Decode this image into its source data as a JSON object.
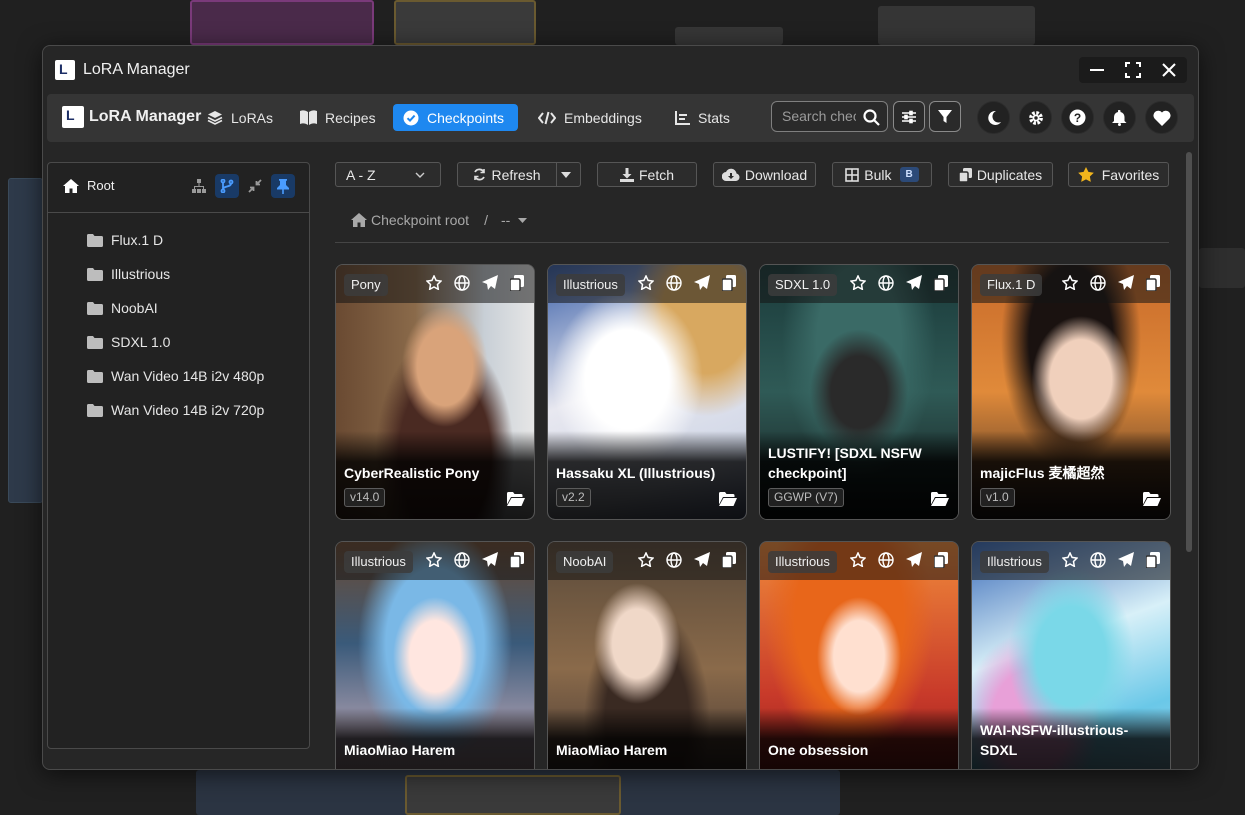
{
  "window": {
    "title": "LoRA Manager"
  },
  "navbar": {
    "brand": "LoRA Manager",
    "items": [
      {
        "label": "LoRAs",
        "icon": "layers-icon",
        "active": false
      },
      {
        "label": "Recipes",
        "icon": "book-icon",
        "active": false
      },
      {
        "label": "Checkpoints",
        "icon": "check-circle-icon",
        "active": true
      },
      {
        "label": "Embeddings",
        "icon": "code-icon",
        "active": false
      },
      {
        "label": "Stats",
        "icon": "chart-icon",
        "active": false
      }
    ],
    "search_placeholder": "Search checkpoints..."
  },
  "sidebar": {
    "root_label": "Root",
    "folders": [
      "Flux.1 D",
      "Illustrious",
      "NoobAI",
      "SDXL 1.0",
      "Wan Video 14B i2v 480p",
      "Wan Video 14B i2v 720p"
    ]
  },
  "toolbar": {
    "sort_value": "A - Z",
    "refresh": "Refresh",
    "fetch": "Fetch",
    "download": "Download",
    "bulk": "Bulk",
    "bulk_badge": "B",
    "duplicates": "Duplicates",
    "favorites": "Favorites"
  },
  "breadcrumb": {
    "root": "Checkpoint root",
    "sep": "/",
    "current": "--"
  },
  "cards": [
    {
      "base": "Pony",
      "name": "CyberRealistic Pony",
      "version": "v14.0"
    },
    {
      "base": "Illustrious",
      "name": "Hassaku XL (Illustrious)",
      "version": "v2.2"
    },
    {
      "base": "SDXL 1.0",
      "name": "LUSTIFY! [SDXL NSFW checkpoint]",
      "version": "GGWP (V7)"
    },
    {
      "base": "Flux.1 D",
      "name": "majicFlus 麦橘超然",
      "version": "v1.0"
    },
    {
      "base": "Illustrious",
      "name": "MiaoMiao Harem",
      "version": ""
    },
    {
      "base": "NoobAI",
      "name": "MiaoMiao Harem",
      "version": ""
    },
    {
      "base": "Illustrious",
      "name": "One obsession",
      "version": ""
    },
    {
      "base": "Illustrious",
      "name": "WAI-NSFW-illustrious-SDXL",
      "version": ""
    }
  ],
  "colors": {
    "accent": "#1e88f0",
    "window_bg": "#262626",
    "navbar_bg": "#353535"
  }
}
